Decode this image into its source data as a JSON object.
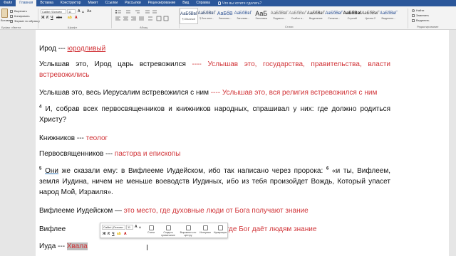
{
  "tabs": [
    "Файл",
    "Главная",
    "Вставка",
    "Конструктор",
    "Макет",
    "Ссылки",
    "Рассылки",
    "Рецензирование",
    "Вид",
    "Справка"
  ],
  "tell_me": "Что вы хотите сделать?",
  "clipboard": {
    "paste": "Вставить",
    "cut": "Вырезать",
    "copy": "Копировать",
    "format_painter": "Формат по образцу",
    "group": "Буфер обмена"
  },
  "font": {
    "name": "Calibri (Основн",
    "size": "11",
    "group": "Шрифт"
  },
  "paragraph": {
    "group": "Абзац"
  },
  "styles": {
    "group": "Стили",
    "items": [
      {
        "sample": "АаБбВвГ",
        "name": "¶ Обычный"
      },
      {
        "sample": "АаБбВвГ",
        "name": "¶ Без инте..."
      },
      {
        "sample": "АаБбВ",
        "name": "Заголово..."
      },
      {
        "sample": "АаБбВвГ",
        "name": "Заголово..."
      },
      {
        "sample": "АаБ",
        "name": "Заголовок"
      },
      {
        "sample": "АаБбВвГ",
        "name": "Подзагол..."
      },
      {
        "sample": "АаБбВеГ",
        "name": "Слабое в..."
      },
      {
        "sample": "АаБбВвГ",
        "name": "Выделение"
      },
      {
        "sample": "АаБбВвГ",
        "name": "Сильное..."
      },
      {
        "sample": "АаБбВвГ",
        "name": "Строгий"
      },
      {
        "sample": "АаБбВвГ",
        "name": "Цитата 2"
      },
      {
        "sample": "АаБбВвГ",
        "name": "Выделенн..."
      }
    ]
  },
  "editing": {
    "find": "Найти",
    "replace": "Заменить",
    "select": "Выделить",
    "group": "Редактирование"
  },
  "document": {
    "p1": {
      "text": "Ирод --- ",
      "red": "юродливый"
    },
    "p2": {
      "text": "Услышав это, Ирод царь встревожился ",
      "red": "---- Услышав это, государства, правительства, власти встревожились"
    },
    "p3": {
      "text": "Услышав это, весь Иерусалим встревожился с ним ",
      "red": "---- Услышав это, вся религия встревожился с ним"
    },
    "p4": {
      "num": "4",
      "text": " И, собрав всех первосвященников и книжников народных, спрашивал у них: где должно родиться Христу?"
    },
    "p5": {
      "text": "Книжников --- ",
      "red": "теолог"
    },
    "p6": {
      "text": "Первосвященников --- ",
      "red": "пастора и епископы"
    },
    "p7": {
      "num": "5",
      "first": "Они",
      "text": " же сказали ему: в Вифлееме Иудейском, ибо так написано через пророка: ",
      "num2": "6",
      "text2": " «и ты, Вифлеем, земля Иудина, ничем не меньше воеводств Иудиных, ибо из тебя произойдет Вождь, Который упасет народ Мой, Израиля»."
    },
    "p8": {
      "text": "Вифлееме Иудейском — ",
      "red": "это место, где духовные люди от Бога получают знание"
    },
    "p9": {
      "text": "Вифлее",
      "red": "сто, где Бог даёт людям знание"
    },
    "p10": {
      "text": "Иуда --- ",
      "red": "Хвала"
    }
  },
  "mini_toolbar": {
    "font": "Calibri (Основн",
    "size": "11",
    "styles": "Стили",
    "new_comment": "Создать примечание",
    "center": "Выровнять по центру",
    "line_spacing": "Интервал",
    "numbering": "Нумерация"
  }
}
